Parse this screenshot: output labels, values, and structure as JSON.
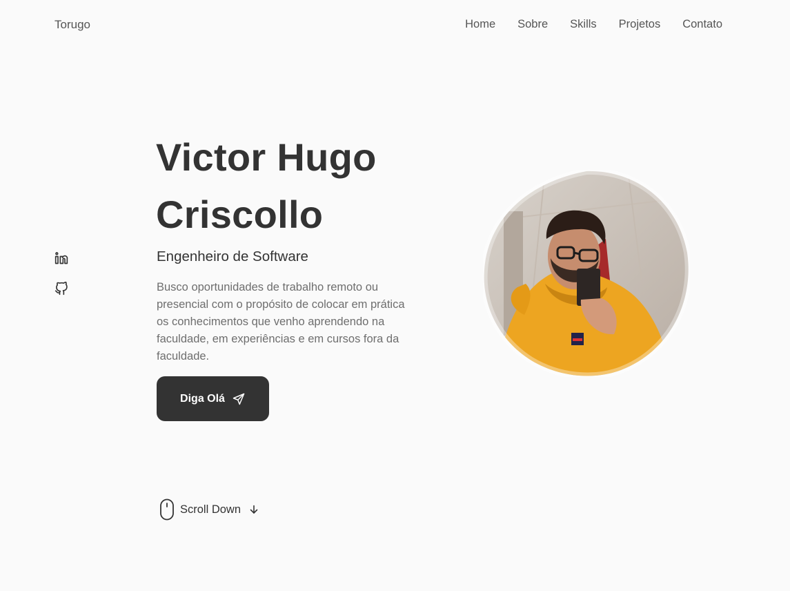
{
  "header": {
    "logo": "Torugo",
    "nav": [
      {
        "label": "Home"
      },
      {
        "label": "Sobre"
      },
      {
        "label": "Skills"
      },
      {
        "label": "Projetos"
      },
      {
        "label": "Contato"
      }
    ]
  },
  "social": [
    {
      "icon": "linkedin-icon"
    },
    {
      "icon": "github-icon"
    }
  ],
  "hero": {
    "title_line1": "Victor Hugo",
    "title_line2": "Criscollo",
    "subtitle": "Engenheiro de Software",
    "description": "Busco oportunidades de trabalho remoto ou presencial com o propósito de colocar em prática os conhecimentos que venho aprendendo na faculdade, em experiências e em cursos fora da faculdade.",
    "cta_label": "Diga Olá",
    "cta_icon": "send-icon"
  },
  "scroll": {
    "label": "Scroll Down",
    "icon": "mouse-icon",
    "arrow_icon": "arrow-down-icon"
  },
  "colors": {
    "background": "#fafafa",
    "text": "#333333",
    "muted": "#6e6e6e",
    "button": "#333333",
    "button_text": "#ffffff"
  }
}
